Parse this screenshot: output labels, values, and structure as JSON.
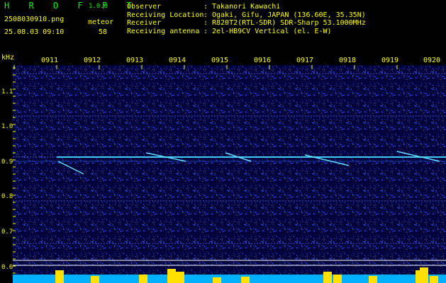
{
  "header": {
    "title": "H R O F F T",
    "version": "1.0.0",
    "filename": "2508030910.png",
    "datetime": "25.08.03 09:10",
    "meteor_label": "meteor",
    "meteor_count": "58"
  },
  "info": [
    {
      "key": "Observer",
      "sep": ":",
      "value": "Takanori Kawachi"
    },
    {
      "key": "Receiving Location",
      "sep": ":",
      "value": "Ogaki, Gifu, JAPAN (136.60E, 35.35N)"
    },
    {
      "key": "Receiver",
      "sep": ":",
      "value": "R820T2(RTL-SDR) SDR-Sharp 53.1000MHz"
    },
    {
      "key": "Receiving antenna",
      "sep": ":",
      "value": "2el-HB9CV Vertical (el. E-W)"
    }
  ],
  "axis": {
    "y_unit": "kHz",
    "y_ticks": [
      "1.1",
      "1.0",
      "0.9",
      "0.8",
      "0.7",
      "0.6"
    ],
    "x_ticks": [
      "0911",
      "0912",
      "0913",
      "0914",
      "0915",
      "0916",
      "0917",
      "0918",
      "0919",
      "0920"
    ]
  },
  "colors": {
    "text": "#ffff00",
    "title": "#00ff00",
    "noise_bg": "#00003a",
    "line": "#40c8ff"
  }
}
